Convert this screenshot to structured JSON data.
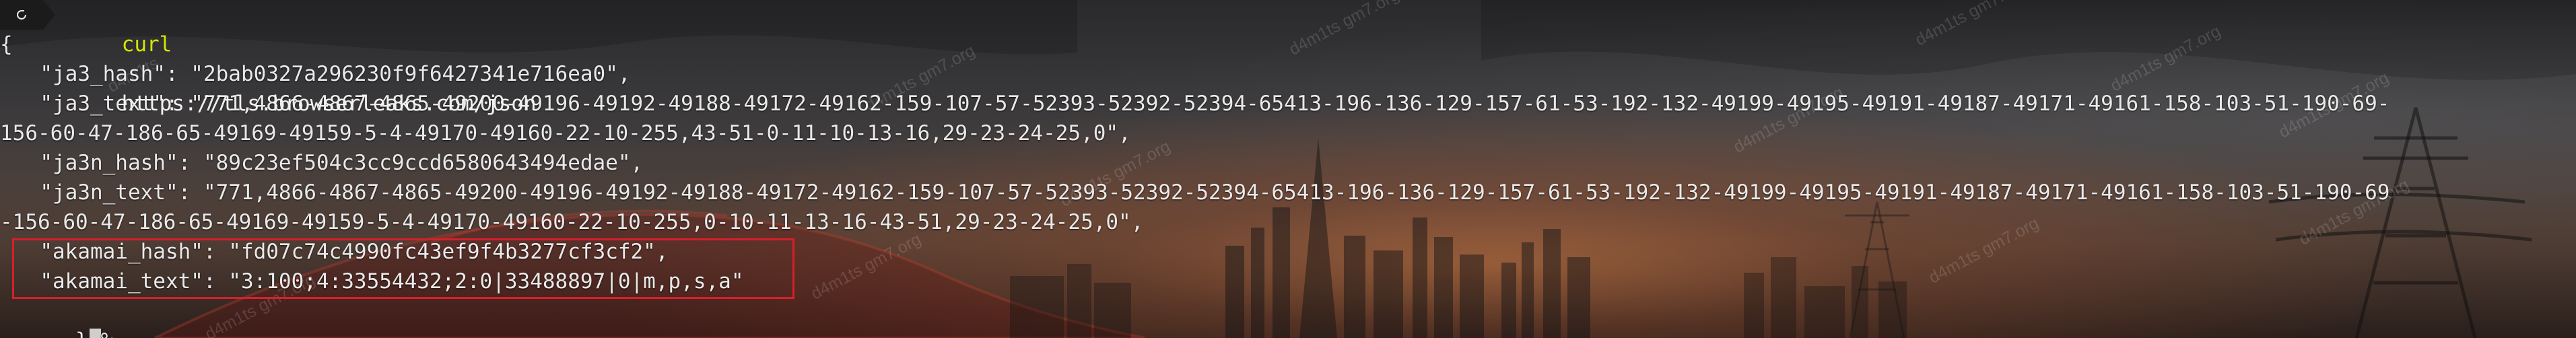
{
  "terminal": {
    "command": {
      "name": "curl",
      "argument": "https://tls.browserleaks.com/json"
    },
    "output_lines": [
      "{",
      "  \"ja3_hash\": \"2bab0327a296230f9f6427341e716ea0\",",
      "  \"ja3_text\": \"771,4866-4867-4865-49200-49196-49192-49188-49172-49162-159-107-57-52393-52392-52394-65413-196-136-129-157-61-53-192-132-49199-49195-49191-49187-49171-49161-158-103-51-190-69-",
      "156-60-47-186-65-49169-49159-5-4-49170-49160-22-10-255,43-51-0-11-10-13-16,29-23-24-25,0\",",
      "  \"ja3n_hash\": \"89c23ef504c3cc9ccd6580643494edae\",",
      "  \"ja3n_text\": \"771,4866-4867-4865-49200-49196-49192-49188-49172-49162-159-107-57-52393-52392-52394-65413-196-136-129-157-61-53-192-132-49199-49195-49191-49187-49171-49161-158-103-51-190-69",
      "-156-60-47-186-65-49169-49159-5-4-49170-49160-22-10-255,0-10-11-13-16-43-51,29-23-24-25,0\",",
      "  \"akamai_hash\": \"fd07c74c4990fc43ef9f4b3277cf3cf2\",",
      "  \"akamai_text\": \"3:100;4:33554432;2:0|33488897|0|m,p,s,a\"",
      "}"
    ],
    "cursor_after": "%"
  },
  "watermark": {
    "text": "d4m1ts gm7.org",
    "short_text": "d4m1ts"
  },
  "colors": {
    "command": "#d5e500",
    "text": "#e9e9e9",
    "highlight_border": "#d71f2b"
  },
  "icons": {
    "prompt": "terminal-prompt-icon"
  }
}
